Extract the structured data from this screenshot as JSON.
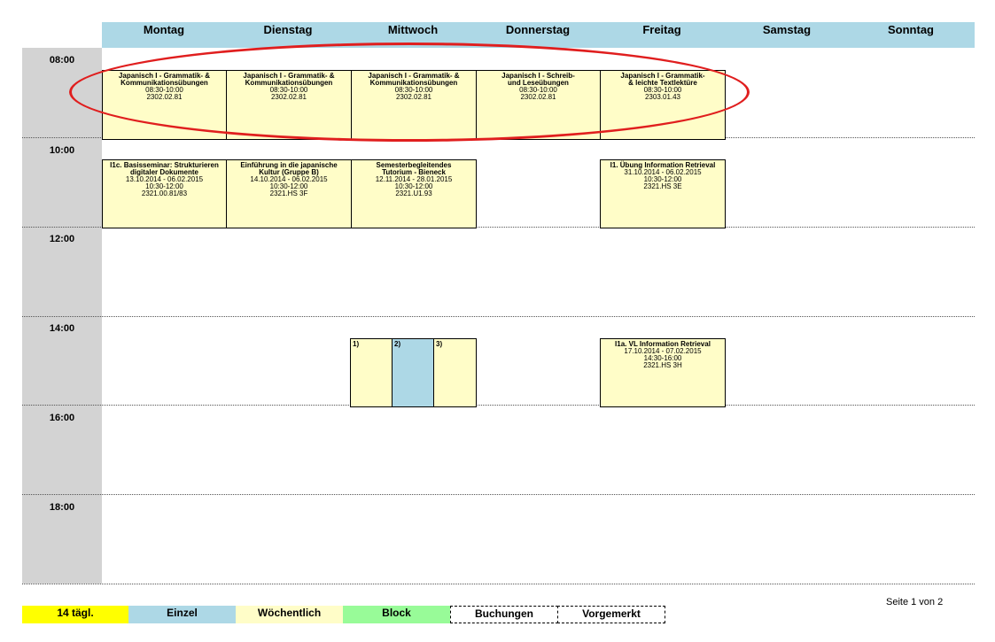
{
  "days": [
    "Montag",
    "Dienstag",
    "Mittwoch",
    "Donnerstag",
    "Freitag",
    "Samstag",
    "Sonntag"
  ],
  "hours": [
    "08:00",
    "10:00",
    "12:00",
    "14:00",
    "16:00",
    "18:00"
  ],
  "events": [
    {
      "lines": [
        "Japanisch I - Grammatik- &",
        "Kommunikationsübungen"
      ],
      "time": "08:30-10:00",
      "room": "2302.02.81"
    },
    {
      "lines": [
        "Japanisch I - Grammatik- &",
        "Kommunikationsübungen"
      ],
      "time": "08:30-10:00",
      "room": "2302.02.81"
    },
    {
      "lines": [
        "Japanisch I - Grammatik- &",
        "Kommunikationsübungen"
      ],
      "time": "08:30-10:00",
      "room": "2302.02.81"
    },
    {
      "lines": [
        "Japanisch I - Schreib-",
        "und Leseübungen"
      ],
      "time": "08:30-10:00",
      "room": "2302.02.81"
    },
    {
      "lines": [
        "Japanisch I - Grammatik-",
        "& leichte Textlektüre"
      ],
      "time": "08:30-10:00",
      "room": "2303.01.43"
    },
    {
      "lines": [
        "I1c. Basisseminar: Strukturieren",
        "digitaler Dokumente"
      ],
      "dates": "13.10.2014 - 06.02.2015",
      "time": "10:30-12:00",
      "room": "2321.00.81/83"
    },
    {
      "lines": [
        "Einführung in die japanische",
        "Kultur (Gruppe B)"
      ],
      "dates": "14.10.2014 - 06.02.2015",
      "time": "10:30-12:00",
      "room": "2321.HS 3F"
    },
    {
      "lines": [
        "Semesterbegleitendes",
        "Tutorium - Bieneck"
      ],
      "dates": "12.11.2014 - 28.01.2015",
      "time": "10:30-12:00",
      "room": "2321.U1.93"
    },
    {
      "lines": [
        "I1. Übung Information Retrieval"
      ],
      "dates": "31.10.2014 - 06.02.2015",
      "time": "10:30-12:00",
      "room": "2321.HS 3E"
    },
    {
      "lines": [
        "I1a. VL Information Retrieval"
      ],
      "dates": "17.10.2014 - 07.02.2015",
      "time": "14:30-16:00",
      "room": "2321.HS 3H"
    }
  ],
  "sub_blocks": [
    {
      "label": "1)",
      "type": "Wöchentlich",
      "color": "#fffdc8"
    },
    {
      "label": "2)",
      "type": "Einzel",
      "color": "#add8e6"
    },
    {
      "label": "3)",
      "type": "Wöchentlich",
      "color": "#fffdc8"
    }
  ],
  "legend": [
    {
      "label": "14 tägl.",
      "color": "#ffff00",
      "dashed": false
    },
    {
      "label": "Einzel",
      "color": "#add8e6",
      "dashed": false
    },
    {
      "label": "Wöchentlich",
      "color": "#fffdc8",
      "dashed": false
    },
    {
      "label": "Block",
      "color": "#98fb98",
      "dashed": false
    },
    {
      "label": "Buchungen",
      "color": "#ffffff",
      "dashed": true
    },
    {
      "label": "Vorgemerkt",
      "color": "#ffffff",
      "dashed": true
    }
  ],
  "page_info": "Seite 1 von 2",
  "highlight_color": "#e01e1e"
}
